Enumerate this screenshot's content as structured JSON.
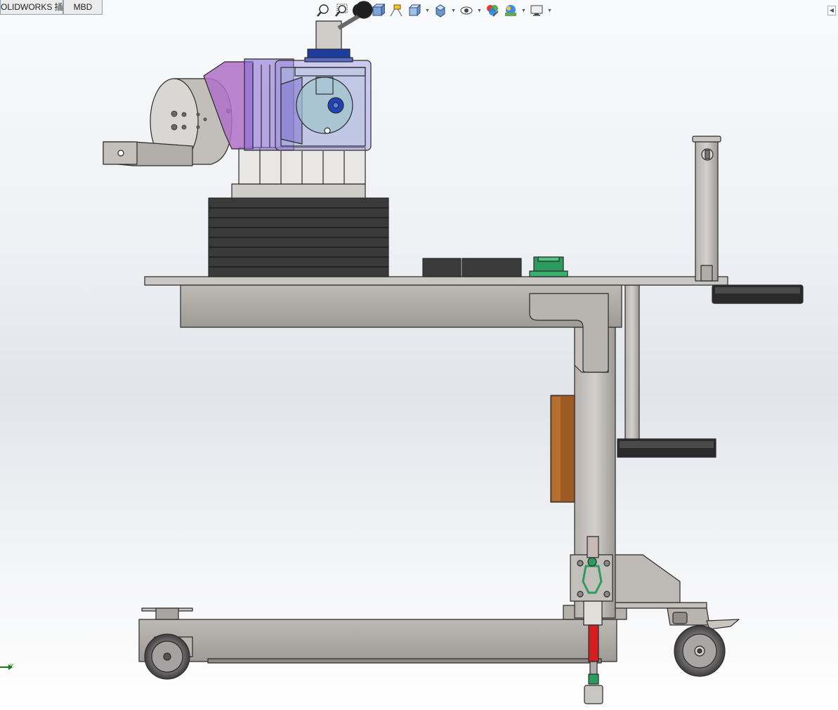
{
  "tabs": [
    {
      "label": "OLIDWORKS 插件"
    },
    {
      "label": "MBD"
    }
  ],
  "heads_up_toolbar": {
    "icons": [
      "zoom-to-fit-icon",
      "zoom-to-area-icon",
      "previous-view-icon",
      "section-view-icon",
      "dynamic-annotation-icon",
      "view-orientation-icon",
      "display-style-icon",
      "hide-show-items-icon",
      "edit-appearance-icon",
      "apply-scene-icon",
      "view-settings-icon"
    ]
  },
  "triad": {
    "axis_label": "Y"
  },
  "colors": {
    "frame_steel": "#a9a6a2",
    "frame_edge": "#2b2b2b",
    "transparent_housing": "#8c6fd6",
    "handle": "#1f1f1f",
    "green_part": "#2e9b5e",
    "red_part": "#d21e1e",
    "wood_block": "#9c5b22",
    "blue_knob": "#1d44b8"
  }
}
